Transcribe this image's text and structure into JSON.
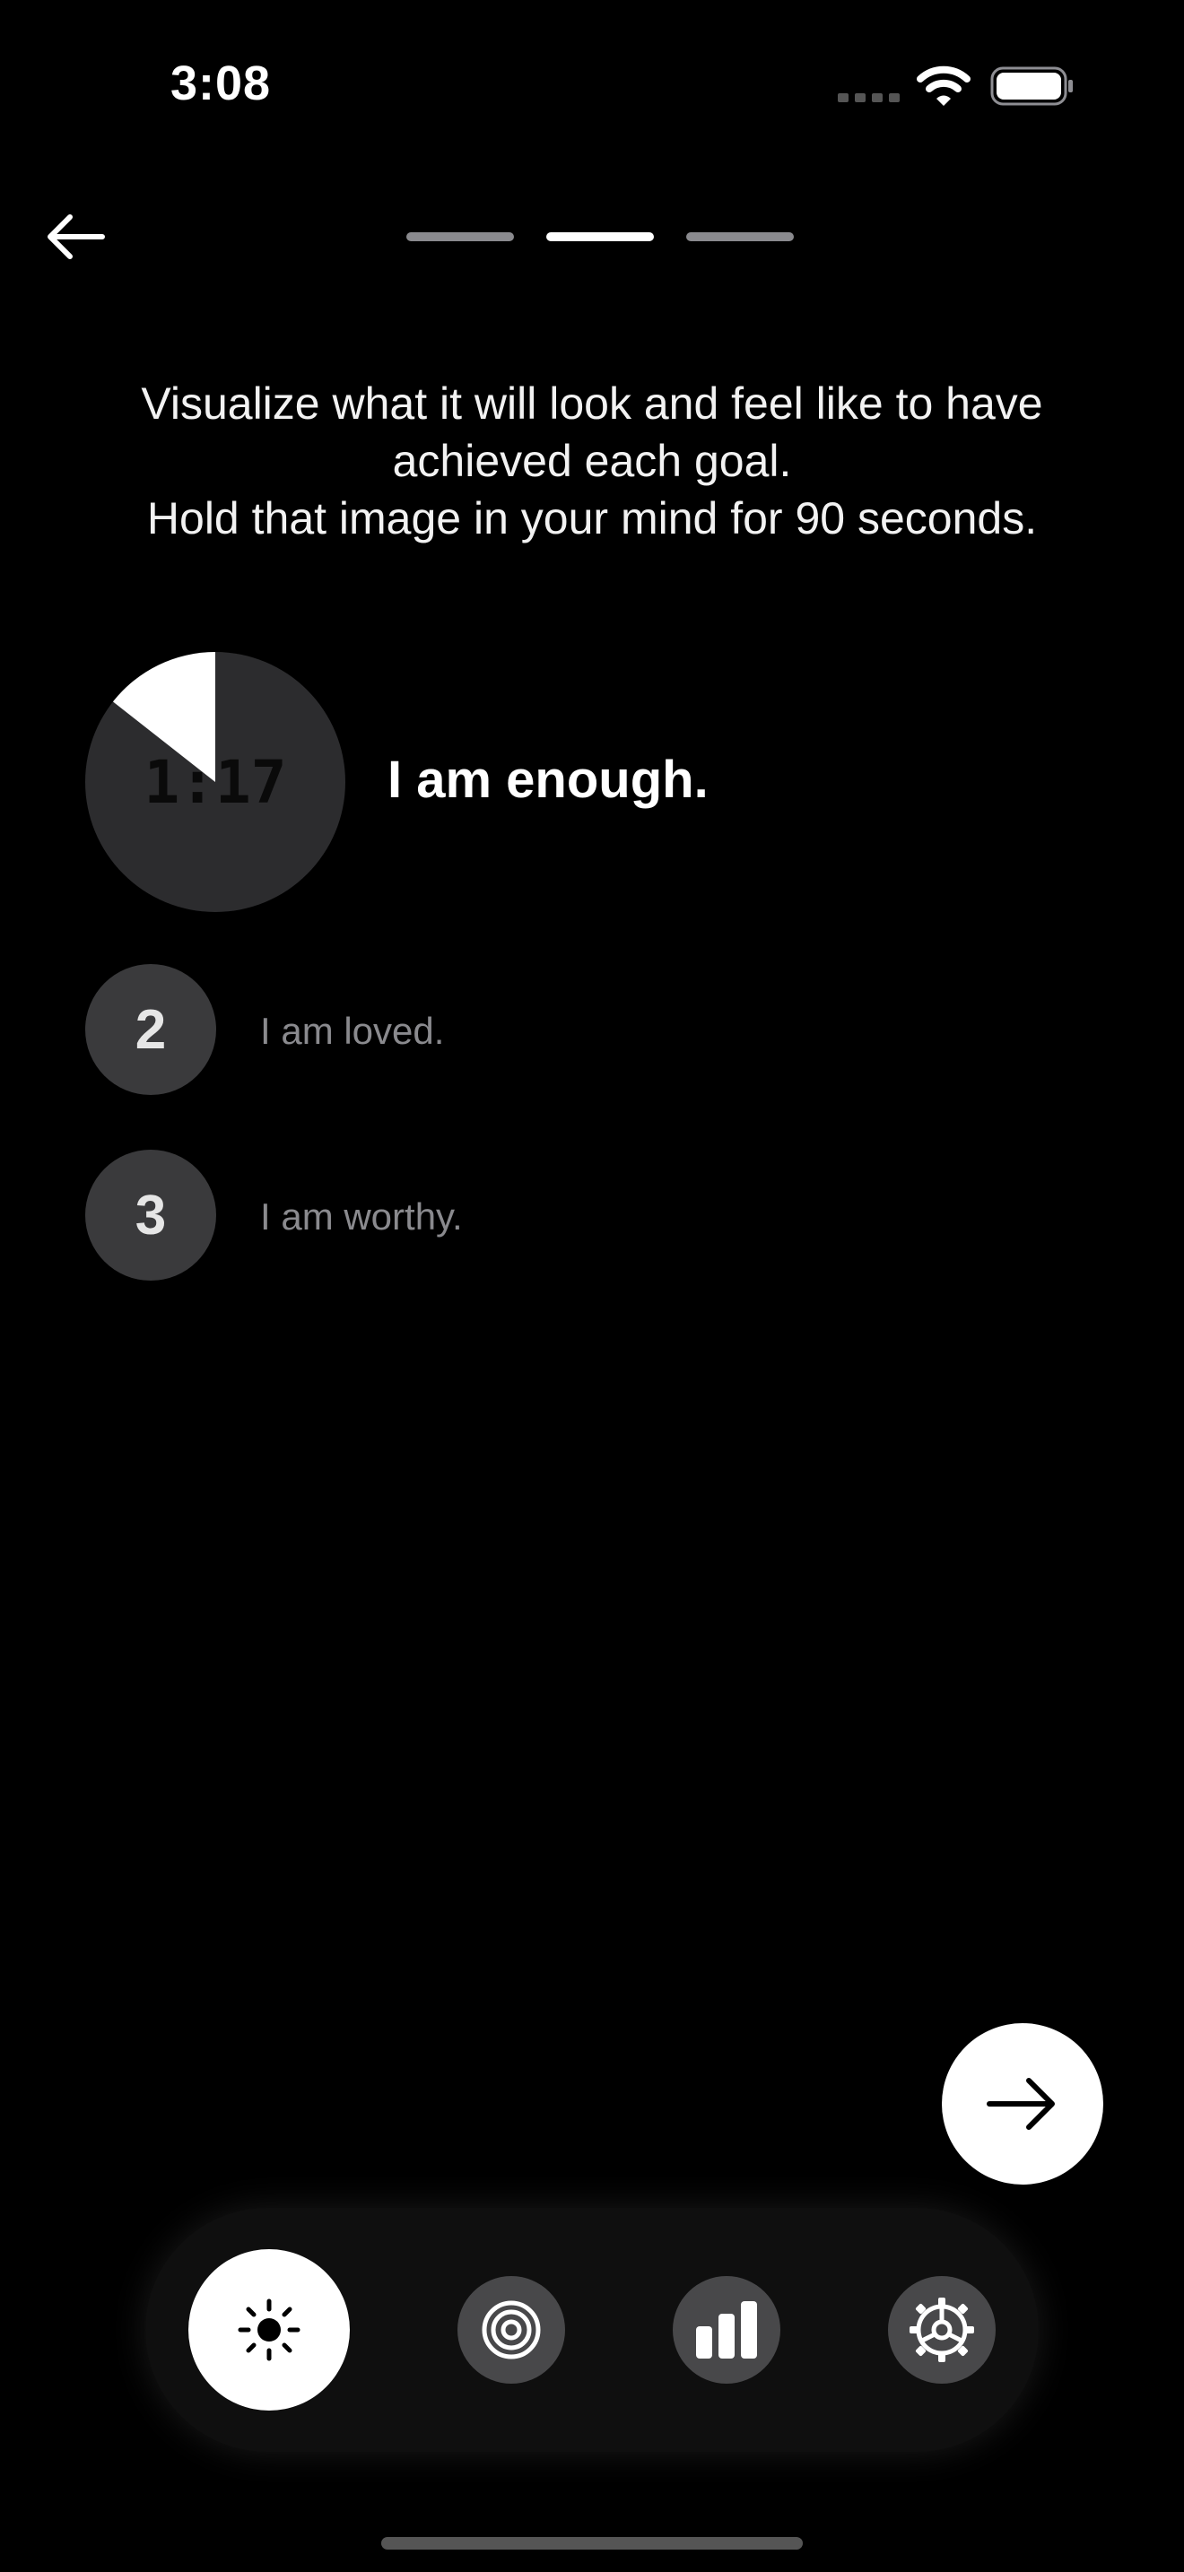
{
  "status_bar": {
    "time": "3:08"
  },
  "header": {
    "back_icon": "arrow-left-icon",
    "steps_total": 3,
    "current_step": 2
  },
  "instructions": {
    "line1": "Visualize what it will look and feel like to have",
    "line2": "achieved each goal.",
    "line3": "Hold that image in your mind for 90 seconds."
  },
  "goals": [
    {
      "number": "1",
      "label": "I am enough.",
      "timer": "1:17",
      "active": true,
      "elapsed_fraction": 0.144
    },
    {
      "number": "2",
      "label": "I am loved.",
      "active": false
    },
    {
      "number": "3",
      "label": "I am worthy.",
      "active": false
    }
  ],
  "next_button": {
    "icon": "arrow-right-icon"
  },
  "tabbar": {
    "tabs": [
      {
        "icon": "sun-icon",
        "active": true
      },
      {
        "icon": "target-icon",
        "active": false
      },
      {
        "icon": "bar-chart-icon",
        "active": false
      },
      {
        "icon": "gear-icon",
        "active": false
      }
    ]
  },
  "colors": {
    "background": "#000000",
    "timer_dial": "#2c2c2e",
    "timer_progress": "#ffffff",
    "inactive_circle": "#3a3a3c",
    "muted_text": "#8a8a8e"
  }
}
